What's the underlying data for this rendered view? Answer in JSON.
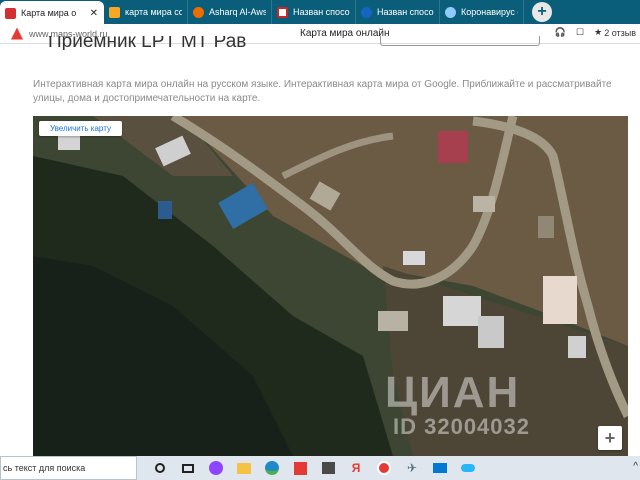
{
  "browser": {
    "tabs": [
      {
        "label": "Карта мира о",
        "icon": "red-map-favicon-icon",
        "color": "#d32f2f",
        "active": true
      },
      {
        "label": "карта мира со с",
        "icon": "yellow-map-favicon-icon",
        "color": "#f9a825",
        "active": false
      },
      {
        "label": "Asharq Al-Awsat",
        "icon": "orange-favicon-icon",
        "color": "#ef6c00",
        "active": false
      },
      {
        "label": "Назван способ",
        "icon": "news-favicon-icon",
        "color": "#c62828",
        "active": false
      },
      {
        "label": "Назван способ",
        "icon": "blue-favicon-icon",
        "color": "#1565c0",
        "active": false
      },
      {
        "label": "Коронавирус с",
        "icon": "globe-favicon-icon",
        "color": "#90caf9",
        "active": false
      }
    ],
    "new_tab_label": "+",
    "url": "www.maps-world.ru",
    "page_title": "Карта мира онлайн",
    "reviews": "2 отзыв"
  },
  "page": {
    "heading_partial": "Приемник LPT МТ Рав",
    "intro": "Интерактивная карта мира онлайн на русском языке. Интерактивная карта мира от Google. Приближайте и рассматривайте улицы, дома и достопримечательности на карте.",
    "map": {
      "enlarge_button": "Увеличить карту",
      "zoom_in": "+",
      "watermark_logo": "ЦИАН",
      "watermark_id": "ID 32004032"
    }
  },
  "taskbar": {
    "search_placeholder": "сь текст для поиска",
    "icons": [
      "search-circle-icon",
      "task-view-icon",
      "alice-icon",
      "file-explorer-icon",
      "edge-icon",
      "gift-icon",
      "store-icon",
      "yandex-ya-icon",
      "yandex-browser-icon",
      "airplane-icon",
      "mail-icon",
      "weather-icon"
    ],
    "tray_arrow": "^"
  },
  "colors": {
    "tabstrip": "#0b5e7a",
    "link_blue": "#1a73e8",
    "warning_red": "#e53935"
  }
}
